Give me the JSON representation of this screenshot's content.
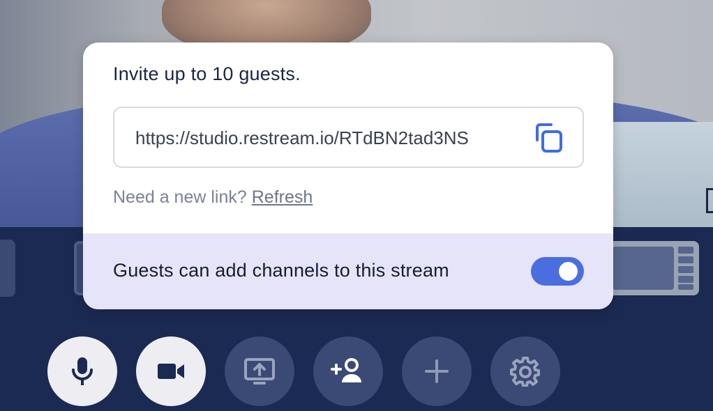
{
  "popup": {
    "title": "Invite up to 10 guests.",
    "invite_link": "https://studio.restream.io/RTdBN2tad3NS",
    "refresh_prompt": "Need a new link?",
    "refresh_label": "Refresh",
    "guest_channels_label": "Guests can add channels to this stream",
    "guest_channels_enabled": true
  },
  "controls": [
    {
      "name": "microphone",
      "icon": "microphone-icon",
      "active": true
    },
    {
      "name": "camera",
      "icon": "video-camera-icon",
      "active": true
    },
    {
      "name": "share-screen",
      "icon": "screen-share-icon",
      "active": false
    },
    {
      "name": "invite-guest",
      "icon": "add-person-icon",
      "active": false
    },
    {
      "name": "add-source",
      "icon": "plus-icon",
      "active": false
    },
    {
      "name": "settings",
      "icon": "gear-icon",
      "active": false
    }
  ],
  "colors": {
    "background": "#1b2a52",
    "accent": "#4a6ee0",
    "footer_tint": "#e6e4f8"
  }
}
